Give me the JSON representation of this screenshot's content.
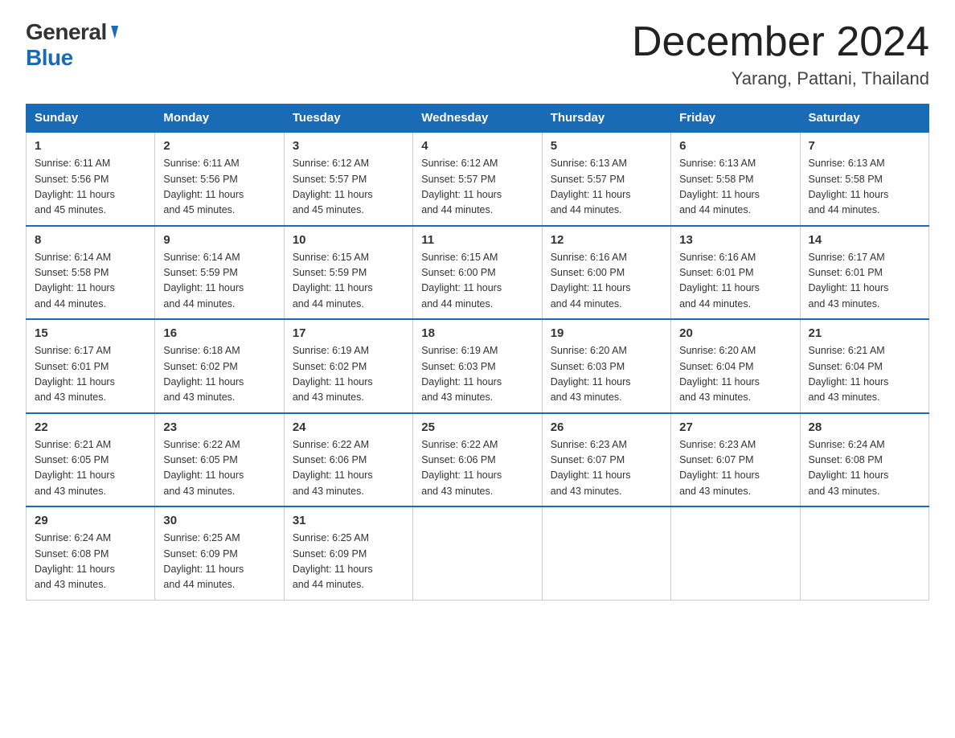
{
  "header": {
    "logo_general": "General",
    "logo_blue": "Blue",
    "title": "December 2024",
    "location": "Yarang, Pattani, Thailand"
  },
  "weekdays": [
    "Sunday",
    "Monday",
    "Tuesday",
    "Wednesday",
    "Thursday",
    "Friday",
    "Saturday"
  ],
  "weeks": [
    [
      {
        "day": "1",
        "sunrise": "6:11 AM",
        "sunset": "5:56 PM",
        "daylight": "11 hours and 45 minutes."
      },
      {
        "day": "2",
        "sunrise": "6:11 AM",
        "sunset": "5:56 PM",
        "daylight": "11 hours and 45 minutes."
      },
      {
        "day": "3",
        "sunrise": "6:12 AM",
        "sunset": "5:57 PM",
        "daylight": "11 hours and 45 minutes."
      },
      {
        "day": "4",
        "sunrise": "6:12 AM",
        "sunset": "5:57 PM",
        "daylight": "11 hours and 44 minutes."
      },
      {
        "day": "5",
        "sunrise": "6:13 AM",
        "sunset": "5:57 PM",
        "daylight": "11 hours and 44 minutes."
      },
      {
        "day": "6",
        "sunrise": "6:13 AM",
        "sunset": "5:58 PM",
        "daylight": "11 hours and 44 minutes."
      },
      {
        "day": "7",
        "sunrise": "6:13 AM",
        "sunset": "5:58 PM",
        "daylight": "11 hours and 44 minutes."
      }
    ],
    [
      {
        "day": "8",
        "sunrise": "6:14 AM",
        "sunset": "5:58 PM",
        "daylight": "11 hours and 44 minutes."
      },
      {
        "day": "9",
        "sunrise": "6:14 AM",
        "sunset": "5:59 PM",
        "daylight": "11 hours and 44 minutes."
      },
      {
        "day": "10",
        "sunrise": "6:15 AM",
        "sunset": "5:59 PM",
        "daylight": "11 hours and 44 minutes."
      },
      {
        "day": "11",
        "sunrise": "6:15 AM",
        "sunset": "6:00 PM",
        "daylight": "11 hours and 44 minutes."
      },
      {
        "day": "12",
        "sunrise": "6:16 AM",
        "sunset": "6:00 PM",
        "daylight": "11 hours and 44 minutes."
      },
      {
        "day": "13",
        "sunrise": "6:16 AM",
        "sunset": "6:01 PM",
        "daylight": "11 hours and 44 minutes."
      },
      {
        "day": "14",
        "sunrise": "6:17 AM",
        "sunset": "6:01 PM",
        "daylight": "11 hours and 43 minutes."
      }
    ],
    [
      {
        "day": "15",
        "sunrise": "6:17 AM",
        "sunset": "6:01 PM",
        "daylight": "11 hours and 43 minutes."
      },
      {
        "day": "16",
        "sunrise": "6:18 AM",
        "sunset": "6:02 PM",
        "daylight": "11 hours and 43 minutes."
      },
      {
        "day": "17",
        "sunrise": "6:19 AM",
        "sunset": "6:02 PM",
        "daylight": "11 hours and 43 minutes."
      },
      {
        "day": "18",
        "sunrise": "6:19 AM",
        "sunset": "6:03 PM",
        "daylight": "11 hours and 43 minutes."
      },
      {
        "day": "19",
        "sunrise": "6:20 AM",
        "sunset": "6:03 PM",
        "daylight": "11 hours and 43 minutes."
      },
      {
        "day": "20",
        "sunrise": "6:20 AM",
        "sunset": "6:04 PM",
        "daylight": "11 hours and 43 minutes."
      },
      {
        "day": "21",
        "sunrise": "6:21 AM",
        "sunset": "6:04 PM",
        "daylight": "11 hours and 43 minutes."
      }
    ],
    [
      {
        "day": "22",
        "sunrise": "6:21 AM",
        "sunset": "6:05 PM",
        "daylight": "11 hours and 43 minutes."
      },
      {
        "day": "23",
        "sunrise": "6:22 AM",
        "sunset": "6:05 PM",
        "daylight": "11 hours and 43 minutes."
      },
      {
        "day": "24",
        "sunrise": "6:22 AM",
        "sunset": "6:06 PM",
        "daylight": "11 hours and 43 minutes."
      },
      {
        "day": "25",
        "sunrise": "6:22 AM",
        "sunset": "6:06 PM",
        "daylight": "11 hours and 43 minutes."
      },
      {
        "day": "26",
        "sunrise": "6:23 AM",
        "sunset": "6:07 PM",
        "daylight": "11 hours and 43 minutes."
      },
      {
        "day": "27",
        "sunrise": "6:23 AM",
        "sunset": "6:07 PM",
        "daylight": "11 hours and 43 minutes."
      },
      {
        "day": "28",
        "sunrise": "6:24 AM",
        "sunset": "6:08 PM",
        "daylight": "11 hours and 43 minutes."
      }
    ],
    [
      {
        "day": "29",
        "sunrise": "6:24 AM",
        "sunset": "6:08 PM",
        "daylight": "11 hours and 43 minutes."
      },
      {
        "day": "30",
        "sunrise": "6:25 AM",
        "sunset": "6:09 PM",
        "daylight": "11 hours and 44 minutes."
      },
      {
        "day": "31",
        "sunrise": "6:25 AM",
        "sunset": "6:09 PM",
        "daylight": "11 hours and 44 minutes."
      },
      null,
      null,
      null,
      null
    ]
  ]
}
